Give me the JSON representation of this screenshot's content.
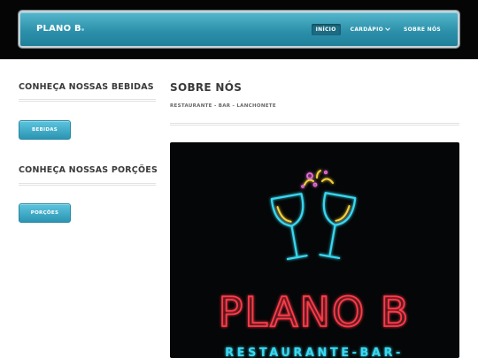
{
  "site": {
    "brand": "PLANO B"
  },
  "nav": {
    "items": [
      {
        "label": "INÍCIO",
        "active": true
      },
      {
        "label": "CARDÁPIO",
        "dropdown": true
      },
      {
        "label": "SOBRE NÓS"
      }
    ]
  },
  "sidebar": {
    "bebidas_heading": "CONHEÇA NOSSAS BEBIDAS",
    "bebidas_button": "BEBIDAS",
    "porcoes_heading": "CONHEÇA NOSSAS PORÇÕES",
    "porcoes_button": "PORÇÕES"
  },
  "main": {
    "title": "SOBRE NÓS",
    "subtitle": "RESTAURANTE - BAR - LANCHONETE",
    "hero": {
      "logo_text": "PLANO B",
      "tagline": "RESTAURANTE-BAR-",
      "icon": "toasting-glasses-icon"
    }
  },
  "colors": {
    "accent": "#2d91ab",
    "neon_red": "#ff3b4a",
    "neon_cyan": "#38d8f0",
    "neon_yellow": "#f5d23a",
    "neon_pink": "#e86ad8"
  }
}
